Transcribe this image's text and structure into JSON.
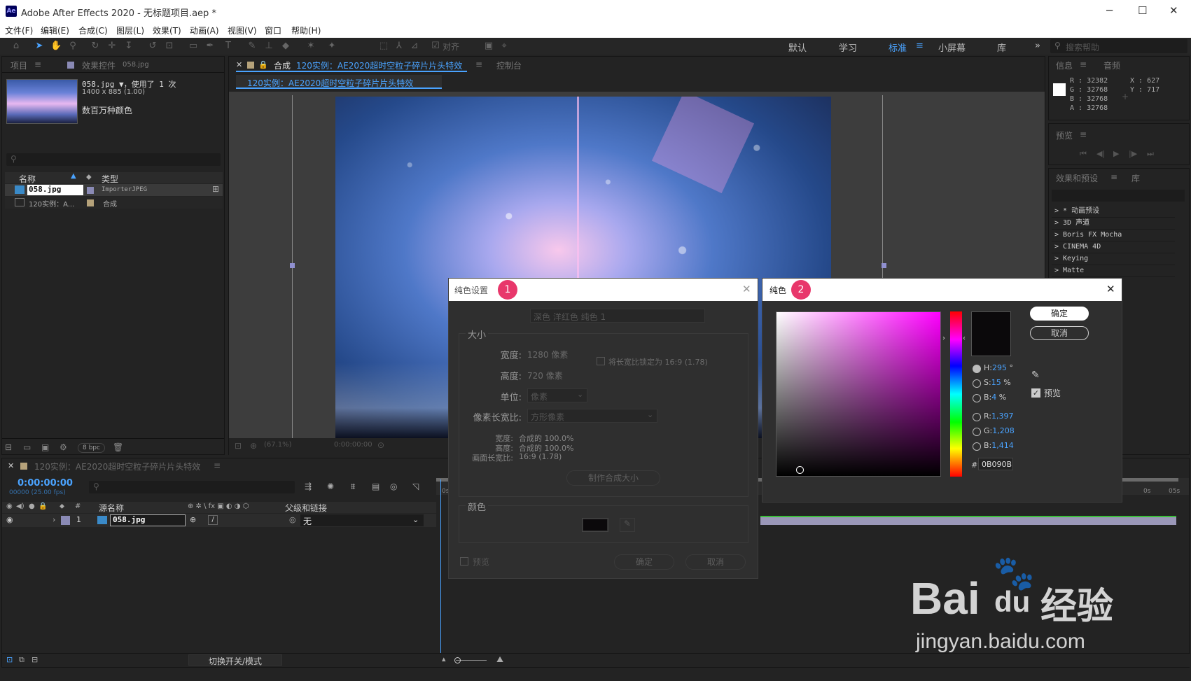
{
  "window": {
    "title": "Adobe After Effects 2020 - 无标题项目.aep *",
    "logo": "Ae",
    "minimize": "─",
    "maximize": "☐",
    "close": "✕"
  },
  "menu": [
    "文件(F)",
    "编辑(E)",
    "合成(C)",
    "图层(L)",
    "效果(T)",
    "动画(A)",
    "视图(V)",
    "窗口",
    "帮助(H)"
  ],
  "toolbar": {
    "snap_label": "对齐",
    "workspaces": [
      "默认",
      "学习",
      "标准",
      "小屏幕",
      "库"
    ],
    "active_workspace": "标准",
    "search_placeholder": "搜索帮助"
  },
  "project": {
    "tab_project": "项目",
    "tab_effects": "效果控件",
    "tab_effects_file": "058.jpg",
    "file_name": "058.jpg ▼，使用了 1 次",
    "file_dims": "1400 x 885 (1.00)",
    "file_colors": "数百万种颜色",
    "col_name": "名称",
    "col_type": "类型",
    "items": [
      {
        "name": "058.jpg",
        "type": "ImporterJPEG",
        "color": "#8a8ab5"
      },
      {
        "name": "120实例：A...",
        "type": "合成",
        "color": "#b5a27a"
      }
    ],
    "bpc": "8 bpc"
  },
  "composition": {
    "tab_label": "合成",
    "tab_name": "120实例：AE2020超时空粒子碎片片头特效",
    "tab_console": "控制台",
    "breadcrumb": "120实例：AE2020超时空粒子碎片片头特效",
    "zoom": "(67.1%)",
    "time": "0:00:00:00"
  },
  "info": {
    "tab_info": "信息",
    "tab_audio": "音频",
    "r": "R : 32382",
    "g": "G : 32768",
    "b": "B : 32768",
    "a": "A : 32768",
    "x": "X : 627",
    "y": "Y : 717"
  },
  "preview": {
    "tab": "预览"
  },
  "effects_presets": {
    "tab": "效果和预设",
    "tab_lib": "库",
    "items": [
      "> * 动画预设",
      "> 3D 声道",
      "> Boris FX Mocha",
      "> CINEMA 4D",
      "> Keying",
      "> Matte"
    ]
  },
  "timeline": {
    "tab_name": "120实例：AE2020超时空粒子碎片片头特效",
    "timecode": "0:00:00:00",
    "frames": "00000 (25.00 fps)",
    "col_source": "源名称",
    "col_parent": "父级和链接",
    "layer_num": "1",
    "layer_name": "058.jpg",
    "parent_value": "无",
    "toggle_label": "切换开关/模式",
    "ruler_start": "0s",
    "ruler_mid": "0s",
    "ruler_end": "05s"
  },
  "solid_settings": {
    "title": "纯色设置",
    "badge": "1",
    "name_label": "名称:",
    "name_value": "深色 洋红色 纯色 1",
    "size_label": "大小",
    "width_label": "宽度:",
    "width_value": "1280 像素",
    "height_label": "高度:",
    "height_value": "720 像素",
    "lock_label": "将长宽比锁定为 16:9 (1.78)",
    "unit_label": "单位:",
    "unit_value": "像素",
    "par_label": "像素长宽比:",
    "par_value": "方形像素",
    "info_w_label": "宽度:",
    "info_w": "合成的 100.0%",
    "info_h_label": "高度:",
    "info_h": "合成的 100.0%",
    "info_ar_label": "画面长宽比:",
    "info_ar": "16:9 (1.78)",
    "make_comp_size": "制作合成大小",
    "color_label": "颜色",
    "preview_label": "预览",
    "ok": "确定",
    "cancel": "取消",
    "swatch": "#0b090b"
  },
  "color_picker": {
    "title": "纯色",
    "badge": "2",
    "ok": "确定",
    "cancel": "取消",
    "h_label": "H:",
    "h": "295",
    "h_unit": "°",
    "s_label": "S:",
    "s": "15",
    "s_unit": "%",
    "b_label": "B:",
    "b": "4",
    "b_unit": "%",
    "r_label": "R:",
    "r": "1,397",
    "g_label": "G:",
    "g": "1,208",
    "bl_label": "B:",
    "bl": "1,414",
    "hex_label": "#",
    "hex": "0B090B",
    "preview_label": "预览",
    "hue_color": "#ff00ff",
    "current_color": "#0b090b"
  },
  "watermark": {
    "brand": "Bai",
    "brand2": "du",
    "cn": "经验",
    "url": "jingyan.baidu.com"
  }
}
